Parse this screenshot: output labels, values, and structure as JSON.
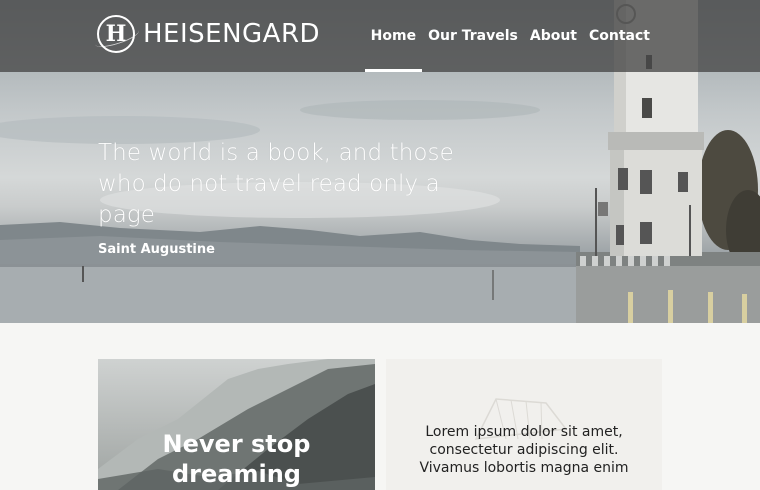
{
  "header": {
    "logo_letter": "H",
    "brand": "HEISENGARD",
    "nav": [
      {
        "label": "Home",
        "active": true
      },
      {
        "label": "Our Travels",
        "active": false
      },
      {
        "label": "About",
        "active": false
      },
      {
        "label": "Contact",
        "active": false
      }
    ]
  },
  "hero": {
    "quote": "The world is a book, and those who do not travel read only a page",
    "author": "Saint Augustine"
  },
  "cards": {
    "left_title": "Never stop dreaming",
    "right_text": "Lorem ipsum dolor sit amet, consectetur adipiscing elit. Vivamus lobortis magna enim"
  },
  "colors": {
    "header_bg": "#464646",
    "page_bg": "#f6f6f4",
    "text_light": "#ffffff",
    "text_dark": "#222222"
  }
}
